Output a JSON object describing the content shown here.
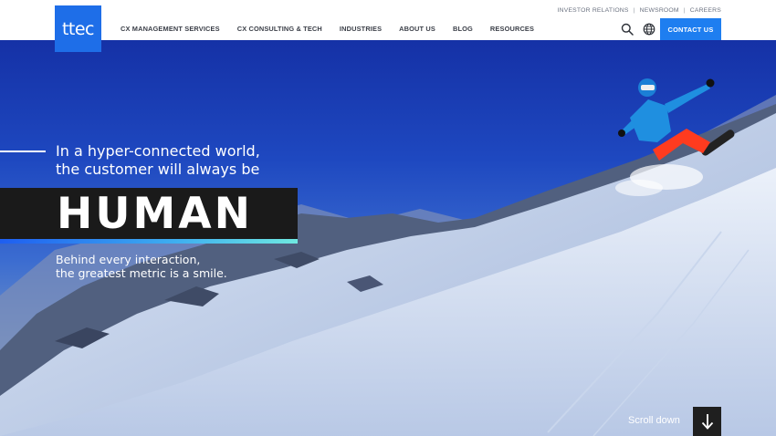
{
  "brand": {
    "logo_text": "ttec",
    "accent": "#1e7ef0",
    "logo_bg": "#1e6ee8"
  },
  "utility_nav": [
    "INVESTOR RELATIONS",
    "NEWSROOM",
    "CAREERS"
  ],
  "main_nav": [
    "CX MANAGEMENT SERVICES",
    "CX CONSULTING & TECH",
    "INDUSTRIES",
    "ABOUT US",
    "BLOG",
    "RESOURCES"
  ],
  "header_actions": {
    "search_icon": "search-icon",
    "globe_icon": "globe-icon",
    "contact_label": "CONTACT US"
  },
  "hero": {
    "headline_1": "In a hyper-connected world,",
    "headline_2": "the customer will always be",
    "emphasis": "HUMAN",
    "sub_1": "Behind every interaction,",
    "sub_2": "the greatest metric is a smile.",
    "scroll_label": "Scroll down",
    "scroll_icon": "arrow-down-icon"
  }
}
